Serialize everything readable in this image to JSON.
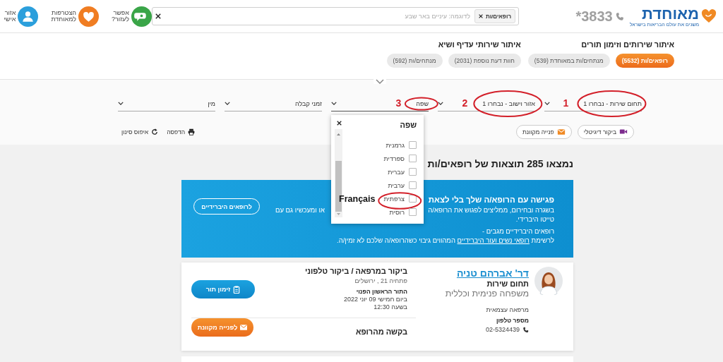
{
  "header": {
    "logo": {
      "name": "מאוחדת",
      "tagline": "משנים את עולם הבריאות בישראל"
    },
    "phone": "*3833",
    "search": {
      "chips": [
        {
          "label": "רופאים/ות"
        }
      ],
      "placeholder": "לדוגמה: עיניים באר שבע"
    },
    "links": [
      {
        "label": "אפשר לעזור?",
        "kind": "help",
        "color": "#3aa548"
      },
      {
        "label": "הצטרפות למאוחדת",
        "kind": "join",
        "color": "#f07d22"
      },
      {
        "label": "אזור אישי",
        "kind": "personal",
        "color": "#2b9fdc"
      }
    ]
  },
  "service_tabs": [
    {
      "title": "איתור שירותים וזימון תורים",
      "pills": [
        {
          "label": "רופאים/ות (5532)",
          "selected": true
        },
        {
          "label": "מנתחים/ות במאוחדת (539)",
          "selected": false
        }
      ]
    },
    {
      "title": "איתור שירותי עדיף ושיא",
      "pills": [
        {
          "label": "חוות דעת נוספת (2031)",
          "selected": false
        },
        {
          "label": "מנתחים/ות (592)",
          "selected": false
        }
      ]
    }
  ],
  "filters": [
    {
      "label": "תחום שירות - נבחרו 1",
      "marker": "1",
      "circled": true,
      "expanded": false
    },
    {
      "label": "אזור וישוב - נבחרו 1",
      "marker": "2",
      "circled": true,
      "expanded": false
    },
    {
      "label": "שפה",
      "marker": "3",
      "circled": true,
      "expanded": true,
      "dropdown": {
        "title": "שפה",
        "options": [
          {
            "label": "גרמנית",
            "checked": false,
            "circled": false
          },
          {
            "label": "ספרדית",
            "checked": false,
            "circled": false
          },
          {
            "label": "עברית",
            "checked": false,
            "circled": false
          },
          {
            "label": "ערבית",
            "checked": false,
            "circled": false
          },
          {
            "label": "צרפתית",
            "checked": false,
            "circled": true,
            "callout": "Français"
          },
          {
            "label": "רוסית",
            "checked": false,
            "circled": false
          }
        ]
      }
    },
    {
      "label": "זמני קבלה",
      "circled": false,
      "expanded": false
    },
    {
      "label": "מין",
      "circled": false,
      "expanded": false
    }
  ],
  "actions": [
    {
      "label": "ביקור דיגיטלי",
      "kind": "video"
    },
    {
      "label": "פנייה מקוונת",
      "kind": "mail"
    }
  ],
  "tools": [
    {
      "label": "הדפסה",
      "kind": "print"
    },
    {
      "label": "איפוס סינון",
      "kind": "reset"
    }
  ],
  "results_title": "נמצאו 285 תוצאות של רופאים/ות",
  "banner": {
    "title": "פגישה עם הרופא/ה שלך בלי לצאת",
    "line_right": "בשגרה ובחירום, ממליצים לפגוש את הרופא/ה",
    "line_left": "או ומעכשיו גם עם",
    "line_end": "טייטו היברידי.",
    "note": "רופאים היברידיים מגבים -",
    "list_before": "לרשימת",
    "list_link": "רופאי נשים ועור היברידיים",
    "list_after": "המהווים גיבוי כשהרופא/ה שלכם לא זמין/ה.",
    "button": "לרופאים היברידיים"
  },
  "doctors": [
    {
      "name": "דר' אברהם טניה",
      "field_label": "תחום שירות",
      "field": "משפחה פנימית וכללית",
      "clinic_type": "מרפאה עצמאית",
      "phone_label": "מספר טלפון",
      "phone": "02-5324439",
      "visit_type": "ביקור במרפאה / ביקור טלפוני",
      "address": "פתחיה 21 , ירושלים",
      "first_slot_label": "התור הראשון הפנוי",
      "first_slot_day": "ביום חמישי 09 יוני 2022",
      "first_slot_time": "בשעה 12:30",
      "book_button": "זימון תור",
      "request_label": "בקשה מהרופא",
      "request_button": "לפנייה מקוונת"
    }
  ]
}
